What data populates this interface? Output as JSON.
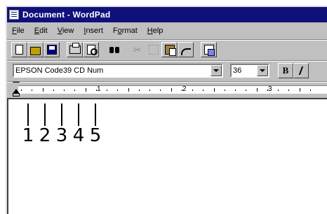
{
  "window": {
    "title": "Document - WordPad"
  },
  "menu": [
    {
      "label": "File",
      "u": "F",
      "rest": "ile"
    },
    {
      "label": "Edit",
      "u": "E",
      "rest": "dit"
    },
    {
      "label": "View",
      "u": "V",
      "rest": "iew"
    },
    {
      "label": "Insert",
      "u": "I",
      "rest": "nsert"
    },
    {
      "label": "Format",
      "u": "o",
      "pre": "F",
      "rest": "rmat"
    },
    {
      "label": "Help",
      "u": "H",
      "rest": "elp"
    }
  ],
  "toolbar": {
    "icons": [
      "new-icon",
      "open-icon",
      "save-icon",
      "print-icon",
      "print-preview-icon",
      "find-icon",
      "cut-icon",
      "copy-icon",
      "paste-icon",
      "undo-icon",
      "date-time-icon"
    ]
  },
  "format": {
    "font_name": "EPSON Code39 CD Num",
    "font_size": "36",
    "bold_label": "B"
  },
  "ruler": {
    "numbers": [
      "1",
      "2",
      "3"
    ]
  },
  "document": {
    "digits": [
      "1",
      "2",
      "3",
      "4",
      "5"
    ]
  }
}
